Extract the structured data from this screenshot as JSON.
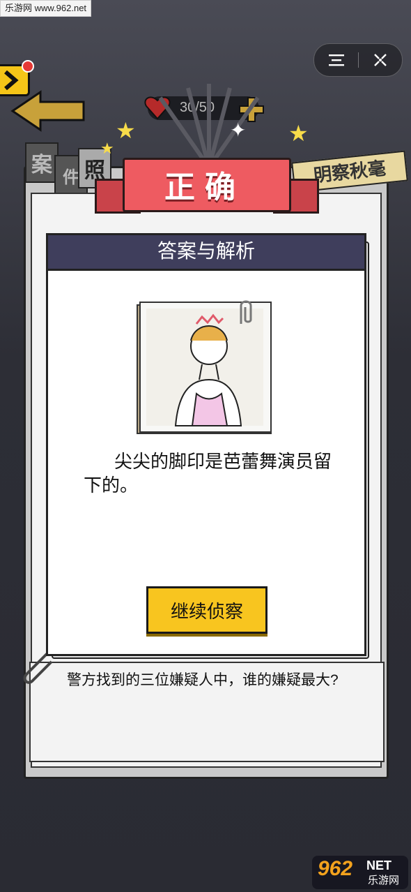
{
  "watermark_top": "乐游网 www.962.net",
  "hearts": "30/50",
  "tabs": [
    "案",
    "件",
    "照"
  ],
  "stamp": "明察秋毫",
  "result": "正确",
  "dialog": {
    "title": "答案与解析",
    "description": "尖尖的脚印是芭蕾舞演员留下的。",
    "continue_label": "继续侦察"
  },
  "question": "警方找到的三位嫌疑人中，谁的嫌疑最大?",
  "watermark_bottom": {
    "number": "962",
    "net": "NET",
    "cn": "乐游网"
  },
  "colors": {
    "ribbon": "#ee5b61",
    "dialog_header": "#3f3e5c",
    "button": "#f8c51f"
  }
}
